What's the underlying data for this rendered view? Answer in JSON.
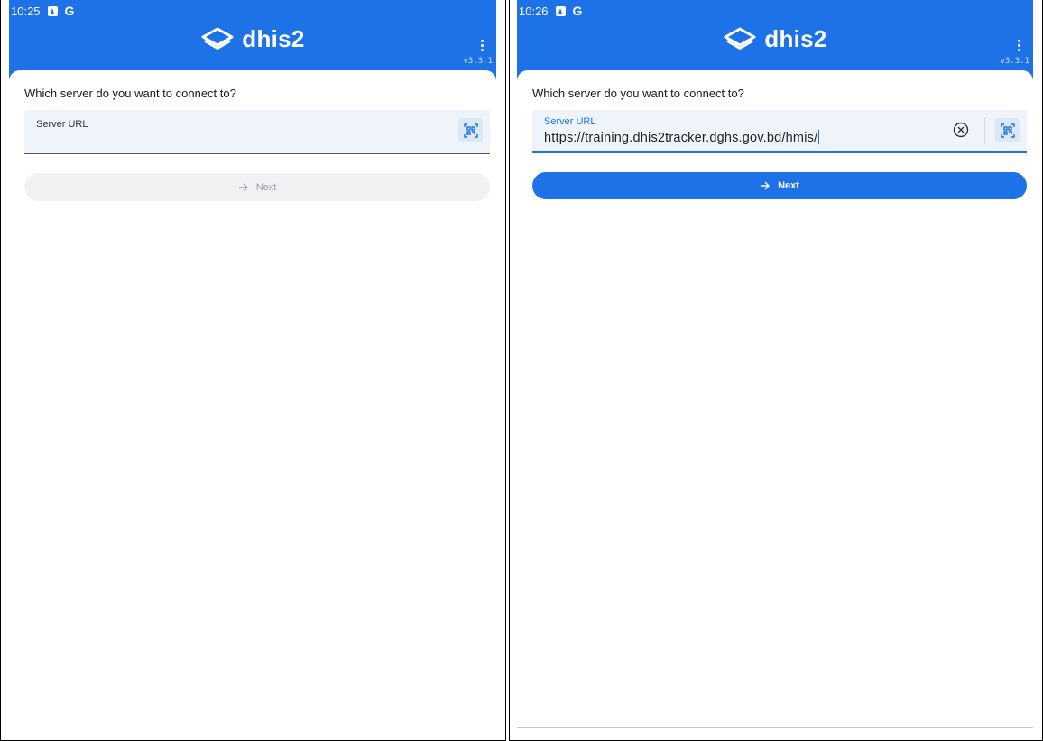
{
  "screens": [
    {
      "status": {
        "time": "10:25",
        "g_icon": "G"
      },
      "header": {
        "brand": "dhis2",
        "version": "v3.3.1",
        "menu_icon": "more-vertical-icon",
        "logo_icon": "dhis2-layers-icon"
      },
      "form": {
        "question": "Which server do you want to connect to?",
        "server_url_label": "Server URL",
        "server_url_value": "",
        "qr_icon": "qr-scan-icon",
        "next_label": "Next",
        "next_enabled": false
      }
    },
    {
      "status": {
        "time": "10:26",
        "g_icon": "G"
      },
      "header": {
        "brand": "dhis2",
        "version": "v3.3.1",
        "menu_icon": "more-vertical-icon",
        "logo_icon": "dhis2-layers-icon"
      },
      "form": {
        "question": "Which server do you want to connect to?",
        "server_url_label": "Server URL",
        "server_url_value": "https://training.dhis2tracker.dghs.gov.bd/hmis/",
        "clear_icon": "clear-circle-icon",
        "qr_icon": "qr-scan-icon",
        "next_label": "Next",
        "next_enabled": true
      }
    }
  ],
  "colors": {
    "primary": "#1d72e8",
    "field_bg": "#eef4fa",
    "disabled_bg": "#eff1f3"
  }
}
